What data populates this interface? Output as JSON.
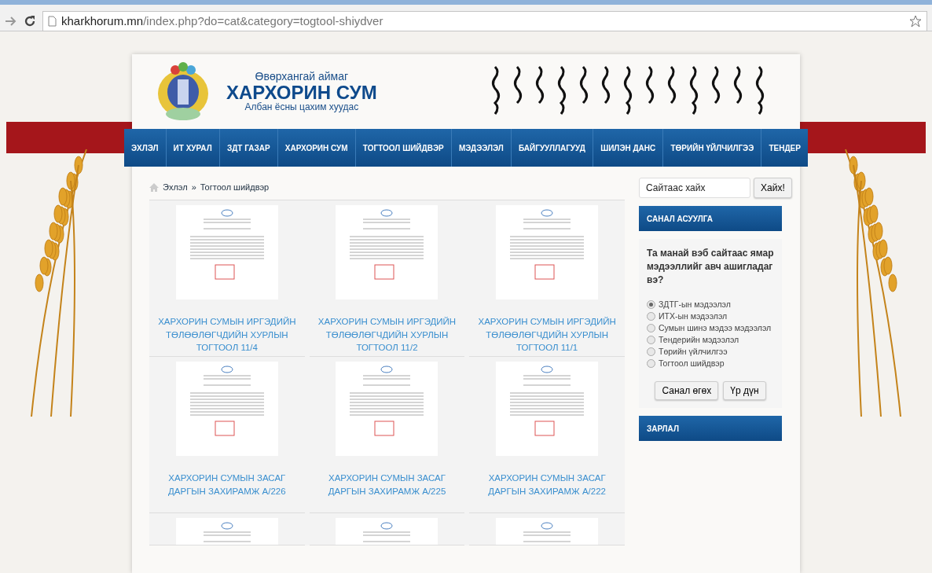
{
  "browser": {
    "url_host": "kharkhorum.mn",
    "url_path": "/index.php?do=cat&category=togtool-shiydver"
  },
  "header": {
    "subtitle": "Өвөрхангай аймаг",
    "title": "ХАРХОРИН СУМ",
    "tagline": "Албан ёсны цахим хуудас"
  },
  "nav": [
    "ЭХЛЭЛ",
    "ИТ ХУРАЛ",
    "ЗДТ ГАЗАР",
    "ХАРХОРИН СУМ",
    "ТОГТООЛ ШИЙДВЭР",
    "МЭДЭЭЛЭЛ",
    "БАЙГУУЛЛАГУУД",
    "ШИЛЭН ДАНС",
    "ТӨРИЙН ҮЙЛЧИЛГЭЭ",
    "ТЕНДЕР"
  ],
  "breadcrumb": {
    "home": "Эхлэл",
    "separator": "»",
    "current": "Тогтоол шийдвэр"
  },
  "items": [
    {
      "title": "ХАРХОРИН СУМЫН ИРГЭДИЙН ТӨЛӨӨЛӨГЧДИЙН ХУРЛЫН ТОГТООЛ 11/4"
    },
    {
      "title": "ХАРХОРИН СУМЫН ИРГЭДИЙН ТӨЛӨӨЛӨГЧДИЙН ХУРЛЫН ТОГТООЛ 11/2"
    },
    {
      "title": "ХАРХОРИН СУМЫН ИРГЭДИЙН ТӨЛӨӨЛӨГЧДИЙН ХУРЛЫН ТОГТООЛ 11/1"
    },
    {
      "title": "ХАРХОРИН СУМЫН ЗАСАГ ДАРГЫН ЗАХИРАМЖ А/226"
    },
    {
      "title": "ХАРХОРИН СУМЫН ЗАСАГ ДАРГЫН ЗАХИРАМЖ А/225"
    },
    {
      "title": "ХАРХОРИН СУМЫН ЗАСАГ ДАРГЫН ЗАХИРАМЖ А/222"
    },
    {
      "partial": true
    },
    {
      "partial": true
    },
    {
      "partial": true
    }
  ],
  "search": {
    "placeholder": "Сайтаас хайх",
    "button": "Хайх!"
  },
  "poll": {
    "heading": "САНАЛ АСУУЛГА",
    "question": "Та манай вэб сайтаас ямар мэдээллийг авч ашигладаг вэ?",
    "options": [
      {
        "label": "ЗДТГ-ын мэдээлэл",
        "selected": true
      },
      {
        "label": "ИТХ-ын мэдээлэл",
        "selected": false
      },
      {
        "label": "Сумын шинэ мэдээ мэдээлэл",
        "selected": false
      },
      {
        "label": "Тендерийн мэдээлэл",
        "selected": false
      },
      {
        "label": "Төрийн үйлчилгээ",
        "selected": false
      },
      {
        "label": "Тогтоол шийдвэр",
        "selected": false
      }
    ],
    "buttons": [
      "Санал өгөх",
      "Үр дүн"
    ]
  },
  "announcements": {
    "heading": "ЗАРЛАЛ"
  }
}
